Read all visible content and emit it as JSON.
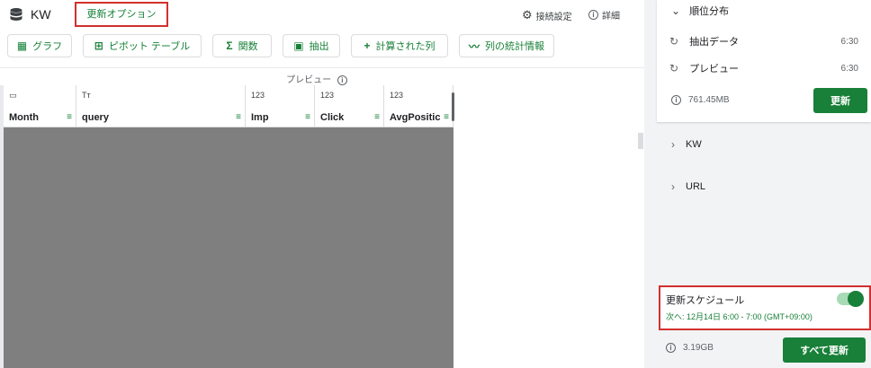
{
  "sheet": {
    "title": "KW"
  },
  "header": {
    "refresh_options": "更新オプション",
    "connection_settings": "接続設定",
    "details": "詳細"
  },
  "toolbar": {
    "chart": "グラフ",
    "pivot_table": "ピボット テーブル",
    "function": "関数",
    "extract": "抽出",
    "calculated_column": "計算された列",
    "column_stats": "列の統計情報"
  },
  "preview": {
    "label": "プレビュー"
  },
  "columns": [
    {
      "type": "",
      "name": "Month"
    },
    {
      "type": "Tт",
      "name": "query"
    },
    {
      "type": "123",
      "name": "Imp"
    },
    {
      "type": "123",
      "name": "Click"
    },
    {
      "type": "123",
      "name": "AvgPositic"
    }
  ],
  "panel": {
    "top_section": "順位分布",
    "items": [
      {
        "label": "抽出データ",
        "time": "6:30"
      },
      {
        "label": "プレビュー",
        "time": "6:30"
      }
    ],
    "size1": "761.45MB",
    "update_button": "更新",
    "sections": [
      "KW",
      "URL"
    ],
    "schedule": {
      "title": "更新スケジュール",
      "next": "次へ: 12月14日 6:00 - 7:00 (GMT+09:00)",
      "enabled": true
    },
    "size2": "3.19GB",
    "update_all_button": "すべて更新"
  },
  "colors": {
    "accent": "#188038",
    "highlight": "#d32f2f"
  }
}
